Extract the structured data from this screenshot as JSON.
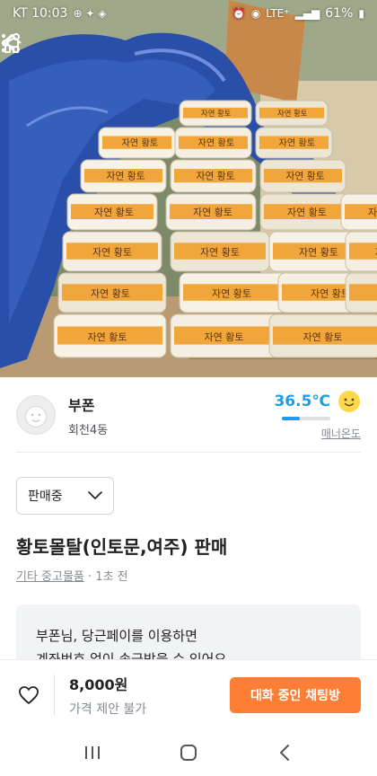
{
  "status_bar": {
    "carrier_time": "KT 10:03",
    "network": "LTE⁺",
    "battery": "61%"
  },
  "nav": {
    "icons": [
      "back-icon",
      "home-icon",
      "share-icon",
      "more-icon"
    ]
  },
  "seller": {
    "name": "부폰",
    "location": "회천4동",
    "manner_temp": "36.5℃",
    "manner_label": "매너온도",
    "manner_level": 0.365
  },
  "listing": {
    "status": "판매중",
    "title": "황토몰탈(인토문,여주) 판매",
    "category": "기타 중고물품",
    "time": " · 1초 전"
  },
  "pay_banner": {
    "line1": "부폰님, 당근페이를 이용하면",
    "line2": "계좌번호 없이 송금받을 수 있어요."
  },
  "action_bar": {
    "price": "8,000원",
    "negotiation": "가격 제안 불가",
    "chat_button": "대화 중인 채팅방"
  },
  "photo": {
    "bag_label_a": "자연",
    "bag_label_b": "황토"
  },
  "colors": {
    "brand_orange": "#ff7e36",
    "manner_blue": "#1a9ee8"
  }
}
